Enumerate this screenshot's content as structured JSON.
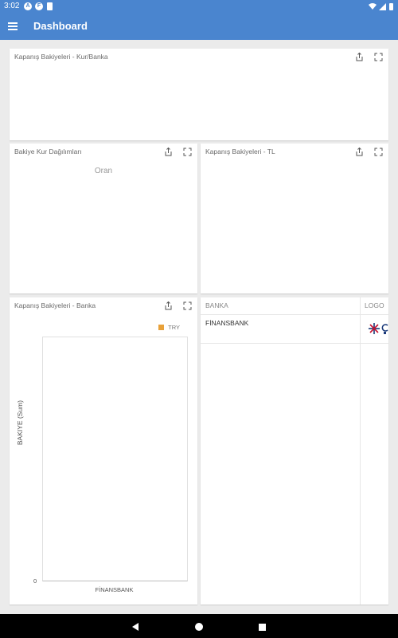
{
  "status": {
    "time": "3:02"
  },
  "app_bar": {
    "title": "Dashboard",
    "menu_icon": "hamburger-menu-icon"
  },
  "cards": {
    "kur_banka": {
      "title": "Kapanış Bakiyeleri - Kur/Banka"
    },
    "kur_dagilimlari": {
      "title": "Bakiye Kur Dağılımları",
      "center_label": "Oran"
    },
    "tl": {
      "title": "Kapanış Bakiyeleri - TL"
    },
    "banka": {
      "title": "Kapanış Bakiyeleri - Banka"
    }
  },
  "chart_data": {
    "type": "bar",
    "categories": [
      "FİNANSBANK"
    ],
    "series": [
      {
        "name": "TRY",
        "values": [
          0
        ],
        "color": "#e8a13a"
      }
    ],
    "ylabel": "BAKIYE (Sum)",
    "y_ticks": [
      "0"
    ],
    "legend": "top-right"
  },
  "table": {
    "columns": [
      "BANKA",
      "LOGO"
    ],
    "rows": [
      {
        "banka": "FİNANSBANK",
        "logo": "qnb-finansbank-logo"
      }
    ]
  },
  "colors": {
    "primary": "#4a85cf",
    "accent": "#e8a13a"
  }
}
